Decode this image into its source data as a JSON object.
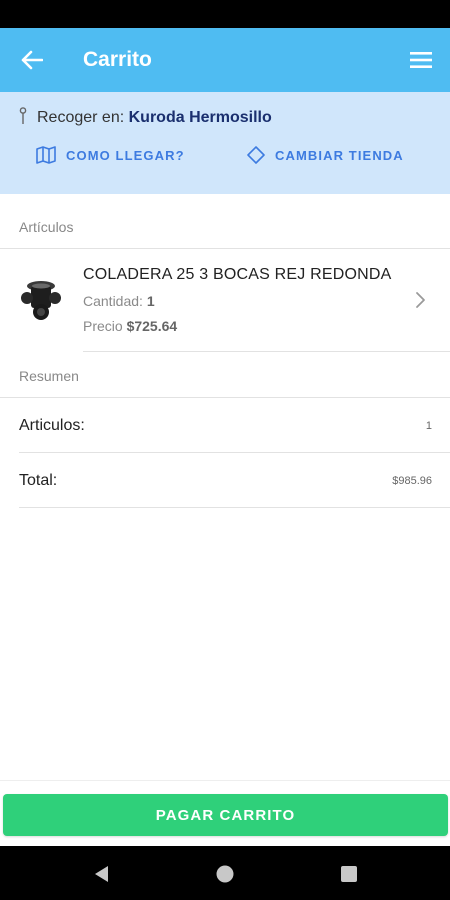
{
  "app_bar": {
    "title": "Carrito",
    "back_icon": "arrow-left-icon",
    "menu_icon": "hamburger-menu-icon",
    "color": "#4fbcf2"
  },
  "store": {
    "pickup_label": "Recoger en:",
    "store_name": "Kuroda Hermosillo",
    "directions_label": "COMO LLEGAR?",
    "change_store_label": "CAMBIAR TIENDA",
    "directions_icon": "map-icon",
    "change_store_icon": "diamond-direction-icon",
    "panel_color": "#d0e6fb"
  },
  "items_section": {
    "header": "Artículos",
    "items": [
      {
        "name": "COLADERA 25 3 BOCAS REJ REDONDA",
        "qty_label": "Cantidad:",
        "qty": "1",
        "price_label": "Precio",
        "price": "$725.64",
        "image_icon": "drain-product-image"
      }
    ]
  },
  "summary": {
    "header": "Resumen",
    "rows": [
      {
        "label": "Articulos:",
        "value": "1"
      },
      {
        "label": "Total:",
        "value": "$985.96"
      }
    ]
  },
  "checkout": {
    "pay_label": "PAGAR CARRITO",
    "color": "#2fd07a"
  },
  "system_nav": {
    "back_icon": "nav-back-triangle-icon",
    "home_icon": "nav-home-circle-icon",
    "recents_icon": "nav-recents-square-icon"
  }
}
